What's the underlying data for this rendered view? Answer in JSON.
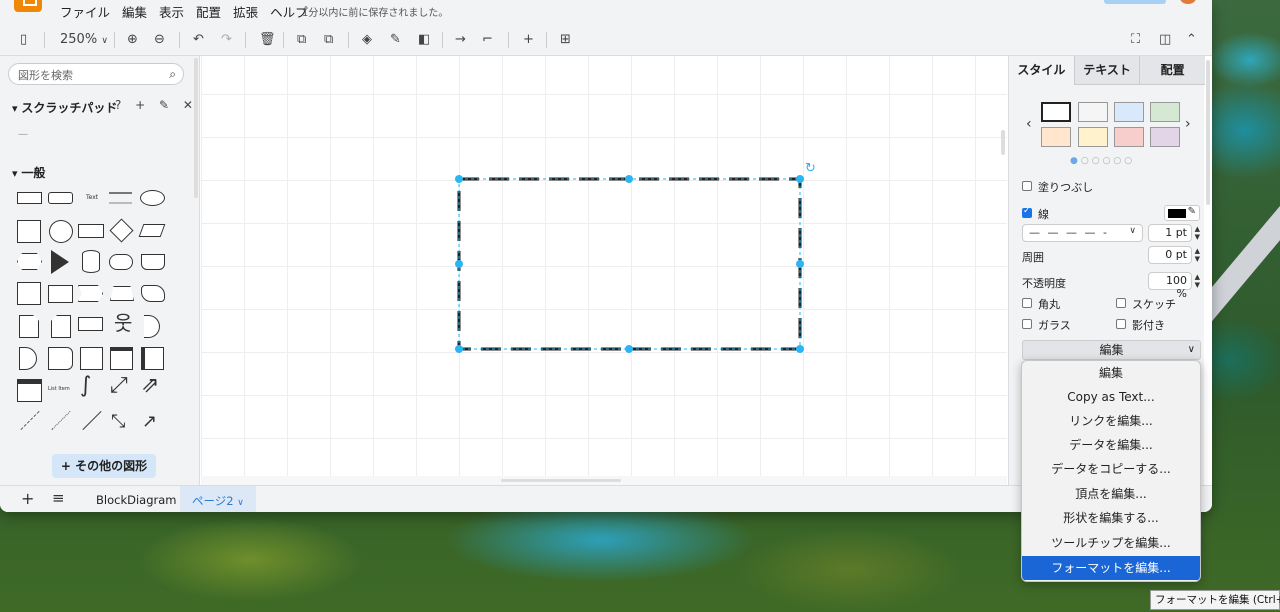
{
  "menubar": {
    "items": [
      "ファイル",
      "編集",
      "表示",
      "配置",
      "拡張",
      "ヘルプ"
    ],
    "saved_status": "1分以内に前に保存されました。"
  },
  "toolbar": {
    "zoom": "250%"
  },
  "sidebar": {
    "search_placeholder": "図形を検索",
    "scratchpad_title": "スクラッチパッド",
    "scratchpad_icons": "? + ✎ ✕",
    "scratchpad_empty": "—",
    "general_title": "一般",
    "text_shape_label": "Text",
    "list_item_label": "List Item",
    "more_shapes": "その他の図形"
  },
  "bottom": {
    "pages": [
      "BlockDiagram",
      "ページ2"
    ],
    "active_page": "ページ2"
  },
  "format_panel": {
    "tabs": [
      "スタイル",
      "テキスト",
      "配置"
    ],
    "swatch_colors": [
      "#ffffff",
      "#f5f5f5",
      "#dae8fc",
      "#d5e8d4",
      "#ffe6cc",
      "#fff2cc",
      "#f8cecc",
      "#e1d5e7"
    ],
    "fill_label": "塗りつぶし",
    "fill_checked": false,
    "line_label": "線",
    "line_checked": true,
    "line_color": "#000000",
    "line_width": "1 pt",
    "perimeter_label": "周囲",
    "perimeter_value": "0 pt",
    "opacity_label": "不透明度",
    "opacity_value": "100 %",
    "rounded_label": "角丸",
    "sketch_label": "スケッチ",
    "glass_label": "ガラス",
    "shadow_label": "影付き",
    "edit_select": "編集"
  },
  "dropdown": {
    "items": [
      "編集",
      "Copy as Text...",
      "リンクを編集...",
      "データを編集...",
      "データをコピーする...",
      "頂点を編集...",
      "形状を編集する...",
      "ツールチップを編集...",
      "フォーマットを編集..."
    ],
    "selected": "フォーマットを編集..."
  },
  "tooltip": "フォーマットを編集 (Ctrl+E)",
  "colors": {
    "accent": "#1a66d6",
    "selection": "#29b6f2",
    "logo": "#f08705"
  }
}
